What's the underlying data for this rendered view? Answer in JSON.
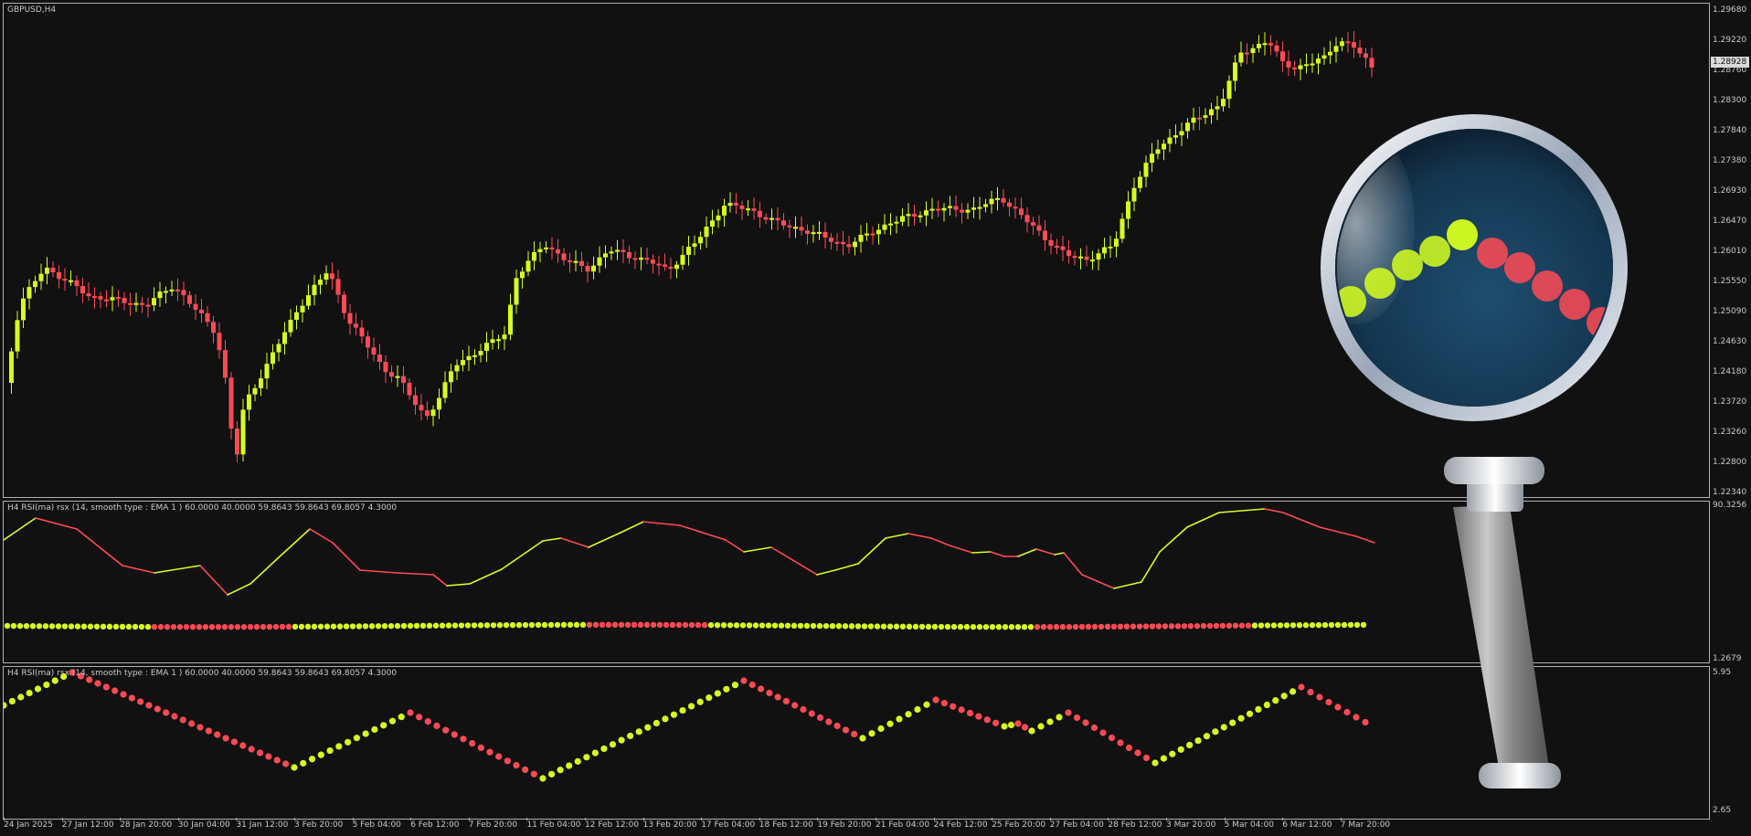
{
  "chart": {
    "symbol_label": "GBPUSD,H4",
    "last_price": "1.28928",
    "colors": {
      "up": "#d7ff1e",
      "down": "#ff4a55",
      "background": "#111111",
      "grid": "#b0b0b0"
    },
    "price_axis": [
      "1.29680",
      "1.29220",
      "1.28760",
      "1.28300",
      "1.27840",
      "1.27380",
      "1.26930",
      "1.26470",
      "1.26010",
      "1.25550",
      "1.25090",
      "1.24630",
      "1.24180",
      "1.23720",
      "1.23260",
      "1.22800",
      "1.22340"
    ],
    "rsi_indicator_label": "H4 RSI(ma) rsx (14, smooth type : EMA   1 ) 60.0000 40.0000 59.8643 59.8643 69.8057 4.3000",
    "rsi_axis": {
      "top": "90.3256",
      "bottom": "1.2679"
    },
    "dot_indicator_label": "H4 RSI(ma) rsx (14, smooth type : EMA   1 ) 60.0000 40.0000 59.8643 59.8643 69.8057 4.3000",
    "dot_axis": {
      "top": "5.95",
      "bottom": "2.65"
    },
    "time_axis": [
      "24 Jan 2025",
      "27 Jan 12:00",
      "28 Jan 20:00",
      "30 Jan 04:00",
      "31 Jan 12:00",
      "3 Feb 20:00",
      "5 Feb 04:00",
      "6 Feb 12:00",
      "7 Feb 20:00",
      "11 Feb 04:00",
      "12 Feb 12:00",
      "13 Feb 20:00",
      "17 Feb 04:00",
      "18 Feb 12:00",
      "19 Feb 20:00",
      "21 Feb 04:00",
      "24 Feb 12:00",
      "25 Feb 20:00",
      "27 Feb 04:00",
      "28 Feb 12:00",
      "3 Mar 20:00",
      "5 Mar 04:00",
      "6 Mar 12:00",
      "7 Mar 20:00"
    ]
  },
  "overlay": {
    "icon": "magnifying-glass-icon"
  }
}
